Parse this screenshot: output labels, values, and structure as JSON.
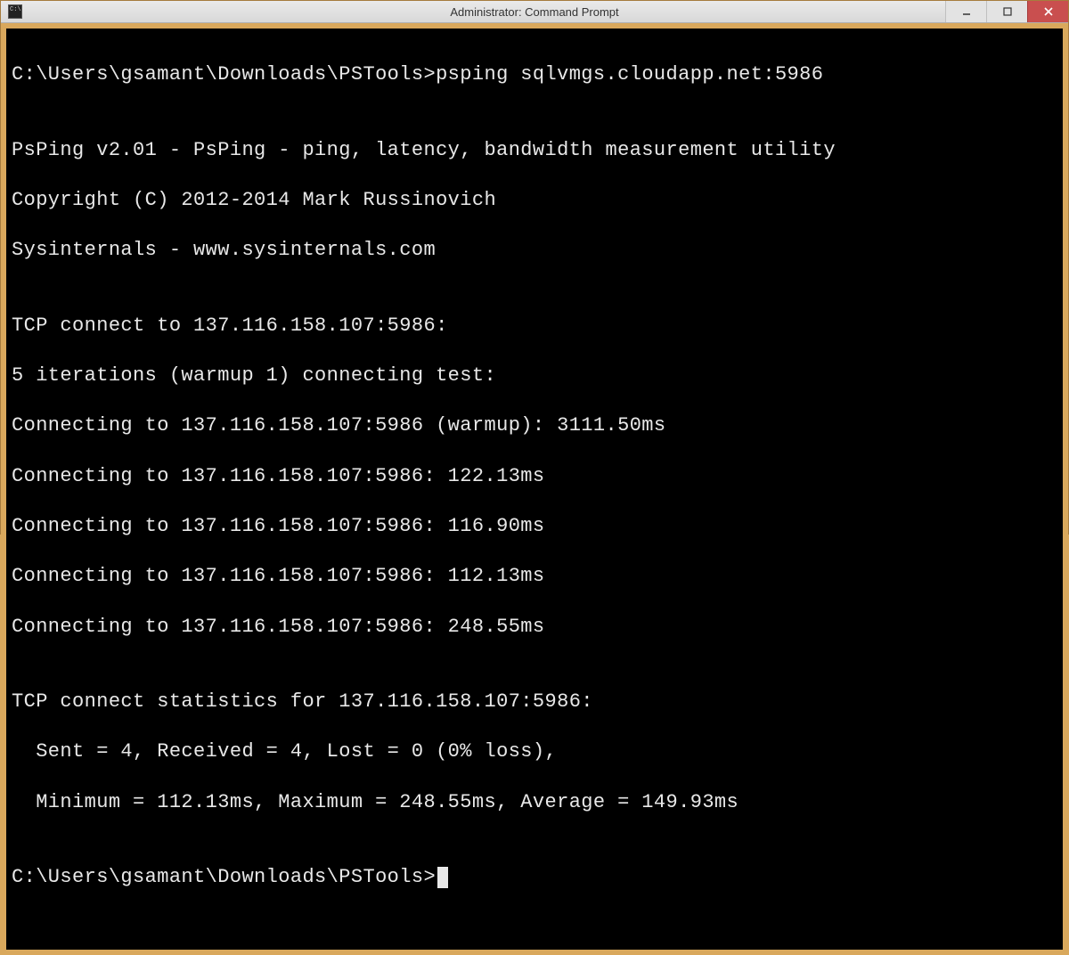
{
  "window": {
    "title": "Administrator: Command Prompt"
  },
  "terminal": {
    "prompt1": "C:\\Users\\gsamant\\Downloads\\PSTools>",
    "command1": "psping sqlvmgs.cloudapp.net:5986",
    "blank": "",
    "banner1": "PsPing v2.01 - PsPing - ping, latency, bandwidth measurement utility",
    "banner2": "Copyright (C) 2012-2014 Mark Russinovich",
    "banner3": "Sysinternals - www.sysinternals.com",
    "tcpconnect": "TCP connect to 137.116.158.107:5986:",
    "iterations": "5 iterations (warmup 1) connecting test:",
    "conn_warmup": "Connecting to 137.116.158.107:5986 (warmup): 3111.50ms",
    "conn1": "Connecting to 137.116.158.107:5986: 122.13ms",
    "conn2": "Connecting to 137.116.158.107:5986: 116.90ms",
    "conn3": "Connecting to 137.116.158.107:5986: 112.13ms",
    "conn4": "Connecting to 137.116.158.107:5986: 248.55ms",
    "stats_header": "TCP connect statistics for 137.116.158.107:5986:",
    "stats_sent": "  Sent = 4, Received = 4, Lost = 0 (0% loss),",
    "stats_minmax": "  Minimum = 112.13ms, Maximum = 248.55ms, Average = 149.93ms",
    "prompt2": "C:\\Users\\gsamant\\Downloads\\PSTools>"
  }
}
